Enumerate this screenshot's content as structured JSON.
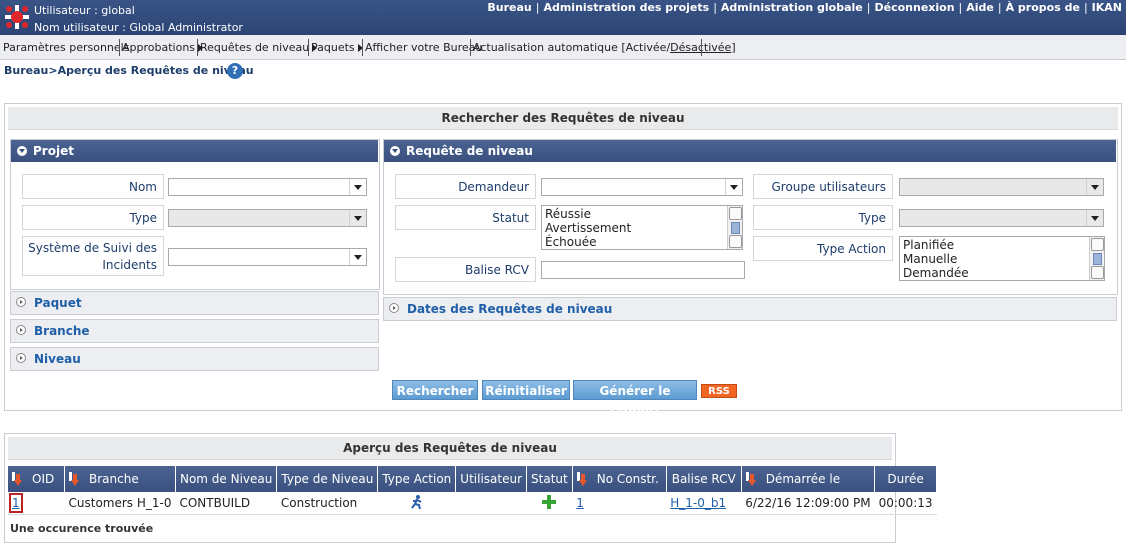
{
  "header": {
    "user_line": "Utilisateur : global",
    "username_line": "Nom utilisateur : Global Administrator",
    "nav": [
      "Bureau",
      "Administration des projets",
      "Administration globale",
      "Déconnexion",
      "Aide",
      "À propos de",
      "IKAN"
    ]
  },
  "subnav": {
    "personal": "Paramètres personnels",
    "approvals": "Approbations",
    "level_requests": "Requêtes de niveau",
    "packages": "Paquets",
    "show_desktop": "Afficher votre Bureau",
    "auto_refresh": "Actualisation automatique [Activée/",
    "auto_refresh_off": "Désactivée",
    "auto_refresh_end": "]"
  },
  "breadcrumb": "Bureau>Aperçu des Requêtes de niveau",
  "search": {
    "title": "Rechercher des Requêtes de niveau",
    "project": {
      "header": "Projet",
      "name_label": "Nom",
      "type_label": "Type",
      "issue_label_1": "Système de Suivi des",
      "issue_label_2": "Incidents"
    },
    "collapsed": [
      "Paquet",
      "Branche",
      "Niveau"
    ],
    "request": {
      "header": "Requête de niveau",
      "requester_label": "Demandeur",
      "status_label": "Statut",
      "status_options": [
        "Réussie",
        "Avertissement",
        "Échouée"
      ],
      "vcr_tag_label": "Balise RCV",
      "user_group_label": "Groupe utilisateurs",
      "type_label": "Type",
      "action_type_label": "Type Action",
      "action_type_options": [
        "Planifiée",
        "Manuelle",
        "Demandée"
      ]
    },
    "dates_header": "Dates des Requêtes de niveau",
    "buttons": {
      "search": "Rechercher",
      "reset": "Réinitialiser",
      "report": "Générer le rapport",
      "rss": "RSS"
    }
  },
  "results": {
    "title": "Aperçu des Requêtes de niveau",
    "columns": [
      "OID",
      "Branche",
      "Nom de Niveau",
      "Type de Niveau",
      "Type Action",
      "Utilisateur",
      "Statut",
      "No Constr.",
      "Balise RCV",
      "Démarrée le",
      "Durée"
    ],
    "rows": [
      {
        "oid": "1",
        "branch": "Customers H_1-0",
        "level_name": "CONTBUILD",
        "level_type": "Construction",
        "action_type_icon": "person-run-icon",
        "user": "",
        "status_icon": "green-plus-icon",
        "build_no": "1",
        "vcr_tag": "H_1-0_b1",
        "started": "6/22/16 12:09:00 PM",
        "duration": "00:00:13"
      }
    ],
    "footer": "Une occurence trouvée"
  },
  "colors": {
    "header": "#2f4a7c",
    "accent": "#1f5fa8",
    "button": "#5c9bd1",
    "rss": "#f26522"
  }
}
